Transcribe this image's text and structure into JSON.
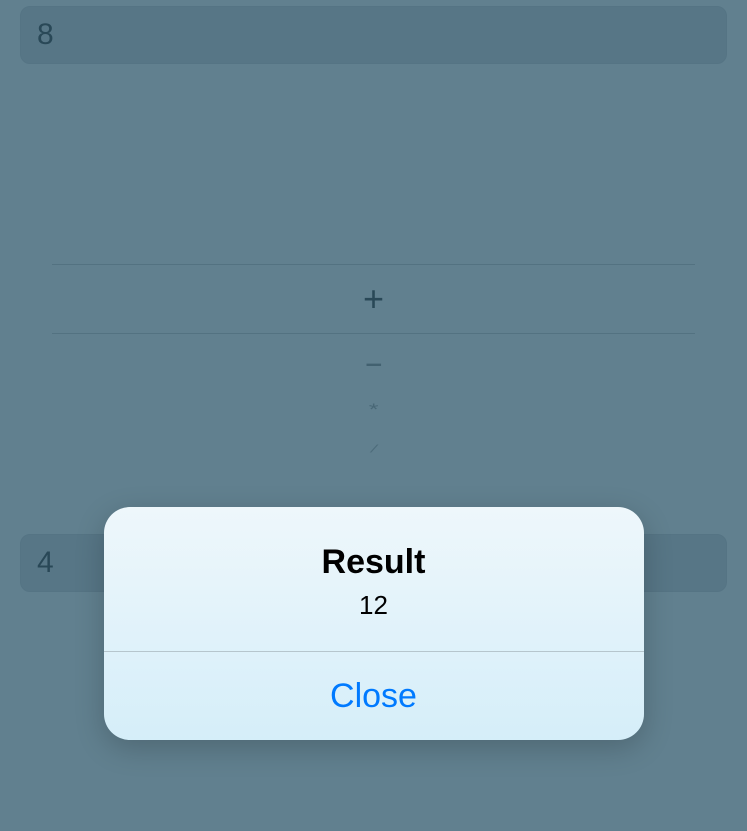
{
  "inputs": {
    "first_operand": "8",
    "second_operand": "4"
  },
  "picker": {
    "selected": "+",
    "options_below": [
      "–",
      "*",
      "/"
    ]
  },
  "alert": {
    "title": "Result",
    "message": "12",
    "close_label": "Close"
  }
}
